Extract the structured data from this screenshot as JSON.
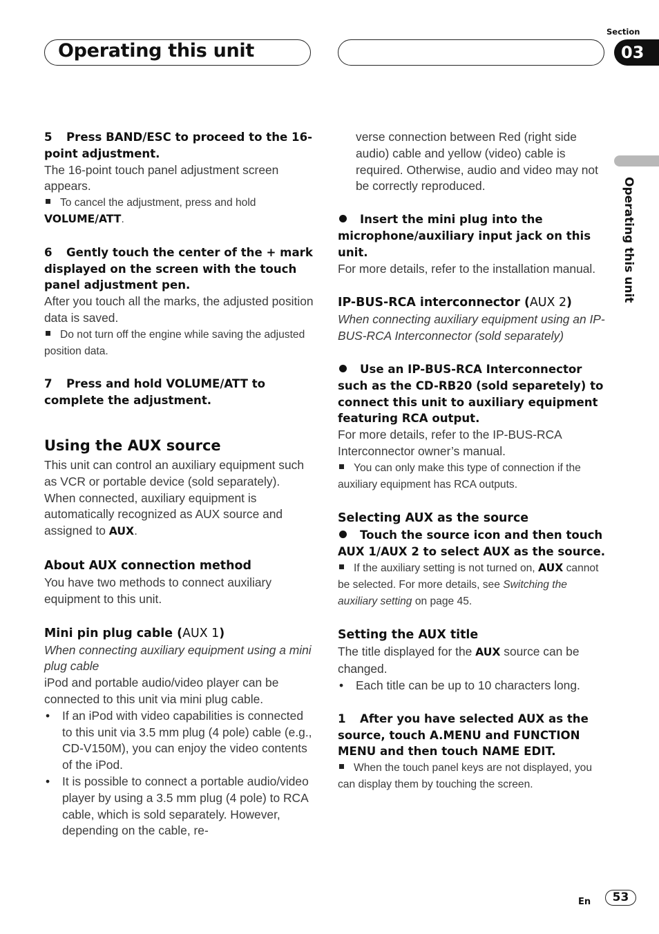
{
  "header": {
    "title": "Operating this unit",
    "section_label": "Section",
    "section_number": "03",
    "side_tab_text": "Operating this unit"
  },
  "left": {
    "step5": {
      "num": "5",
      "title": "Press BAND/ESC to proceed to the 16-point adjustment.",
      "body": "The 16-point touch panel adjustment screen appears.",
      "note_pre": "To cancel the adjustment, press and hold ",
      "note_bold": "VOLUME/ATT",
      "note_post": "."
    },
    "step6": {
      "num": "6",
      "title": "Gently touch the center of the + mark displayed on the screen with the touch panel adjustment pen.",
      "body": "After you touch all the marks, the adjusted position data is saved.",
      "note": "Do not turn off the engine while saving the adjusted position data."
    },
    "step7": {
      "num": "7",
      "title": "Press and hold VOLUME/ATT to complete the adjustment."
    },
    "aux_heading": "Using the AUX source",
    "aux_body_pre": "This unit can control an auxiliary equipment such as VCR or portable device (sold separately). When connected, auxiliary equipment is automatically recognized as AUX source and assigned to ",
    "aux_body_bold": "AUX",
    "aux_body_post": ".",
    "method_heading": "About AUX connection method",
    "method_body": "You have two methods to connect auxiliary equipment to this unit.",
    "mini_heading": "Mini pin plug cable (",
    "mini_heading_light": "AUX 1",
    "mini_heading_close": ")",
    "mini_italic": "When connecting auxiliary equipment using a mini plug cable",
    "mini_body": "iPod and portable audio/video player can be connected to this unit via mini plug cable.",
    "mini_bullets": [
      "If an iPod with video capabilities is connected to this unit via 3.5 mm plug (4 pole) cable (e.g., CD-V150M), you can enjoy the video contents of the iPod.",
      "It is possible to connect a portable audio/video player by using a 3.5 mm plug (4 pole) to RCA cable, which is sold separately. However, depending on the cable, re-"
    ]
  },
  "right": {
    "continued": "verse connection between Red (right side audio) cable and yellow (video) cable is required. Otherwise, audio and video may not be correctly reproduced.",
    "insert_step": "Insert the mini plug into the microphone/auxiliary input jack on this unit.",
    "insert_body": "For more details, refer to the installation manual.",
    "ipbus_heading": "IP-BUS-RCA interconnector (",
    "ipbus_heading_light": "AUX 2",
    "ipbus_heading_close": ")",
    "ipbus_italic": "When connecting auxiliary equipment using an IP-BUS-RCA Interconnector (sold separately)",
    "ipbus_step": "Use an IP-BUS-RCA Interconnector such as the CD-RB20 (sold separetely) to connect this unit to auxiliary equipment featuring RCA output.",
    "ipbus_body": "For more details, refer to the IP-BUS-RCA Interconnector owner’s manual.",
    "ipbus_note": "You can only make this type of connection if the auxiliary equipment has RCA outputs.",
    "select_heading": "Selecting AUX as the source",
    "select_step": "Touch the source icon and then touch AUX 1/AUX 2 to select AUX as the source.",
    "select_note_pre": "If the auxiliary setting is not turned on, ",
    "select_note_bold": "AUX",
    "select_note_mid": " cannot be selected. For more details, see ",
    "select_note_italic": "Switching the auxiliary setting",
    "select_note_post": " on page 45.",
    "title_heading": "Setting the AUX title",
    "title_body_pre": "The title displayed for the ",
    "title_body_bold": "AUX",
    "title_body_post": " source can be changed.",
    "title_bullet": "Each title can be up to 10 characters long.",
    "step1": {
      "num": "1",
      "title": "After you have selected AUX as the source, touch A.MENU and FUNCTION MENU and then touch NAME EDIT.",
      "note": "When the touch panel keys are not displayed, you can display them by touching the screen."
    }
  },
  "footer": {
    "lang": "En",
    "page": "53"
  }
}
